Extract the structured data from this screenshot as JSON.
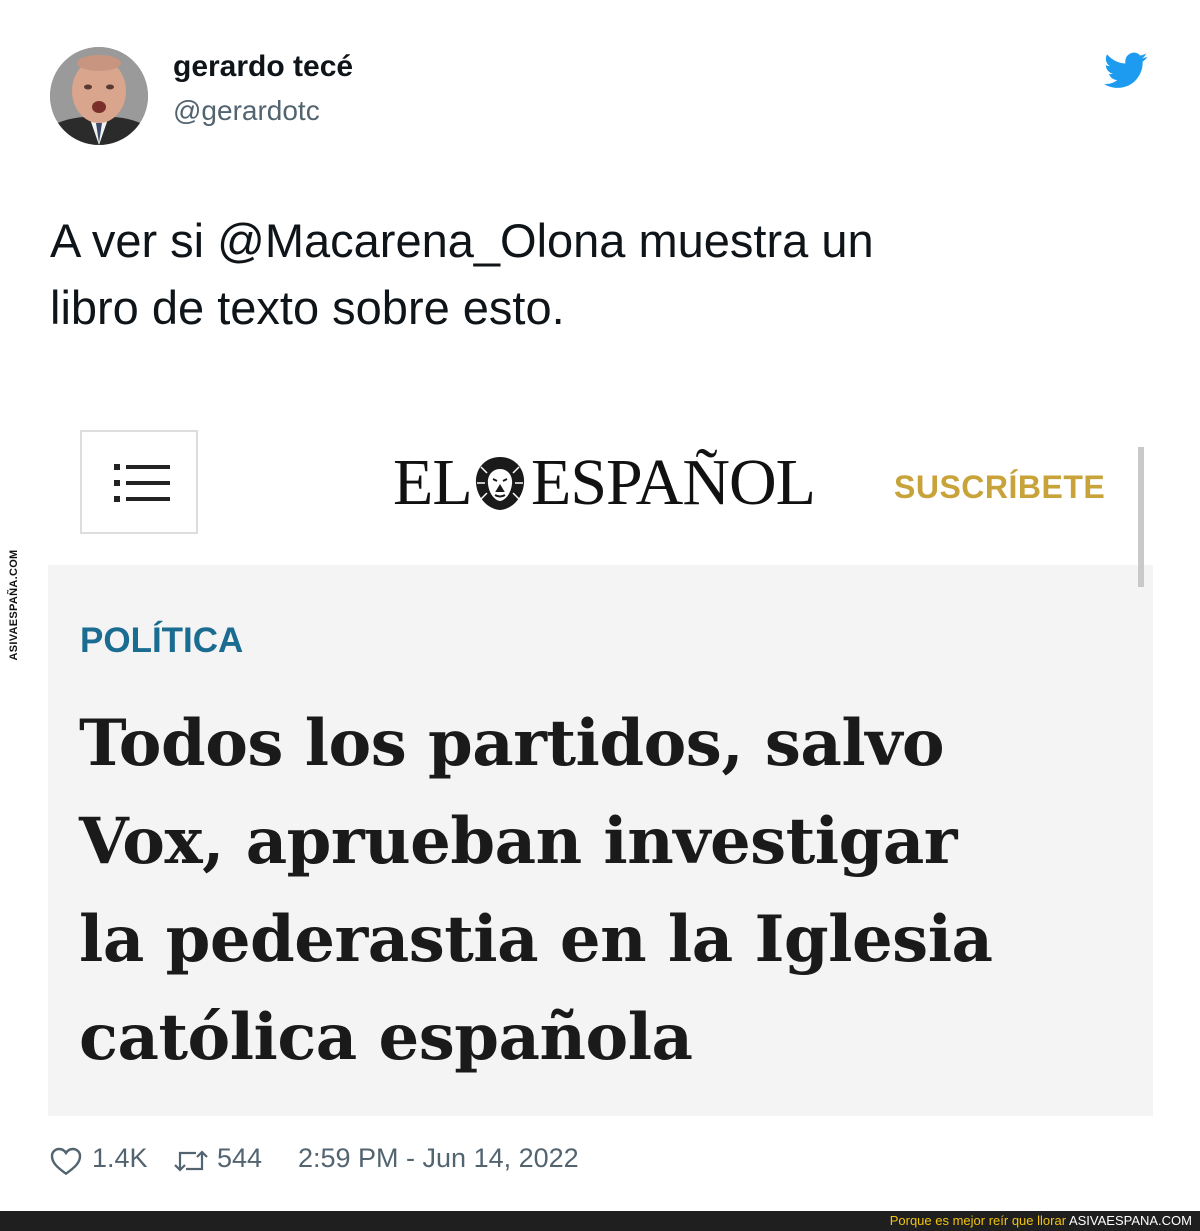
{
  "tweet": {
    "author_name": "gerardo tecé",
    "author_handle": "@gerardotc",
    "text_line1": "A ver si @Macarena_Olona muestra un",
    "text_line2": "libro de texto sobre esto.",
    "likes": "1.4K",
    "retweets": "544",
    "timestamp": "2:59 PM - Jun 14, 2022",
    "icons": {
      "avatar": "avatar",
      "logo": "twitter-bird-icon",
      "like": "heart-icon",
      "retweet": "retweet-icon"
    }
  },
  "embedded_screenshot": {
    "logo_left": "EL",
    "logo_right": "ESPAÑOL",
    "subscribe_label": "SUSCRÍBETE",
    "section": "POLÍTICA",
    "headline_lines": [
      "Todos los partidos, salvo",
      "Vox, aprueban investigar",
      "la pederastia en la Iglesia",
      "católica española"
    ],
    "icons": {
      "menu": "hamburger-menu-icon",
      "logo_mark": "lion-icon"
    }
  },
  "watermark": {
    "side_text": "ASIVAESPAÑA.COM",
    "footer_tagline": "Porque es mejor reír que llorar",
    "footer_site": "ASIVAESPANA.COM"
  },
  "colors": {
    "twitter_blue": "#1d9bf0",
    "subscribe_gold": "#c7a33a",
    "section_blue": "#1b6c91",
    "footer_yellow": "#f0c30f"
  }
}
